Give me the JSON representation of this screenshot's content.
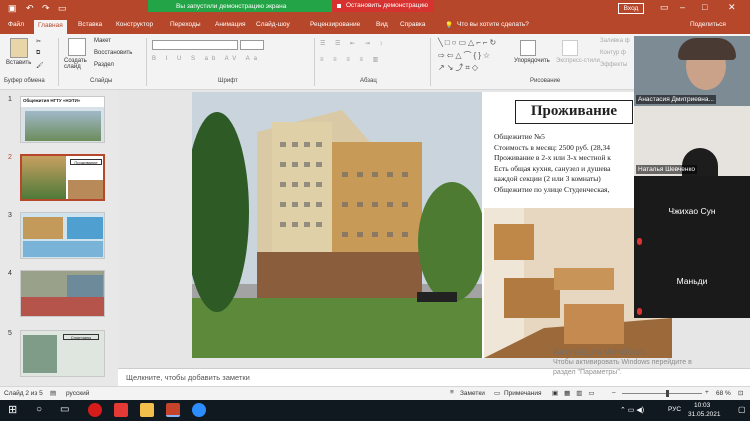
{
  "window": {
    "share_message": "Вы запустили демонстрацию экрана",
    "stop_share_label": "Остановить демонстрацию",
    "login_label": "Вход"
  },
  "tabs": [
    "Файл",
    "Главная",
    "Вставка",
    "Конструктор",
    "Переходы",
    "Анимация",
    "Слайд-шоу",
    "Рецензирование",
    "Вид",
    "Справка"
  ],
  "search": {
    "placeholder": "Что вы хотите сделать?"
  },
  "share_label": "Поделиться",
  "ribbon": {
    "paste": "Вставить",
    "create_slide": "Создать слайд",
    "layout": "Макет",
    "reset": "Восстановить",
    "section": "Раздел",
    "arrange": "Упорядочить",
    "express_styles": "Экспресс-стили",
    "fill": "Заливка ф",
    "outline": "Контур ф",
    "effects": "Эффекты",
    "groups": {
      "clipboard": "Буфер обмена",
      "slides": "Слайды",
      "font": "Шрифт",
      "paragraph": "Абзац",
      "drawing": "Рисование"
    }
  },
  "thumbnails": [
    {
      "num": "1",
      "caption": "Общежития НГТУ «НЭТИ»"
    },
    {
      "num": "2",
      "caption": "Проживание"
    },
    {
      "num": "3",
      "caption": ""
    },
    {
      "num": "4",
      "caption": ""
    },
    {
      "num": "5",
      "caption": "Спортзалы"
    }
  ],
  "slide": {
    "title": "Проживание",
    "lines": [
      "Общежитие №5",
      "Стоимость в месяц: 2500 руб. (28,34",
      "Проживание в 2-х или 3-х местной к",
      "Есть общая кухня, санузел и душева",
      "каждой секции (2 или 3 комнаты)",
      "Общежитие по улице Студенческая,"
    ]
  },
  "notes_placeholder": "Щелкните, чтобы добавить заметки",
  "watermark": {
    "line1": "Активация Windows",
    "line2": "Чтобы активировать Windows перейдите в",
    "line3": "раздел \"Параметры\"."
  },
  "participants": [
    {
      "name": "Анастасия Дмитриевна..."
    },
    {
      "name": "Наталья Шевченко"
    },
    {
      "name": "Чжихао Сун"
    },
    {
      "name": "Маньди"
    }
  ],
  "status": {
    "slide_info": "Слайд 2 из 5",
    "language": "русский",
    "notes": "Заметки",
    "comments": "Примечания",
    "zoom": "68 %"
  },
  "taskbar": {
    "lang": "РУС",
    "time": "10:03",
    "date": "31.05.2021"
  },
  "colors": {
    "accent": "#b7472a",
    "share_green": "#23a447",
    "stop_red": "#d6322f"
  }
}
